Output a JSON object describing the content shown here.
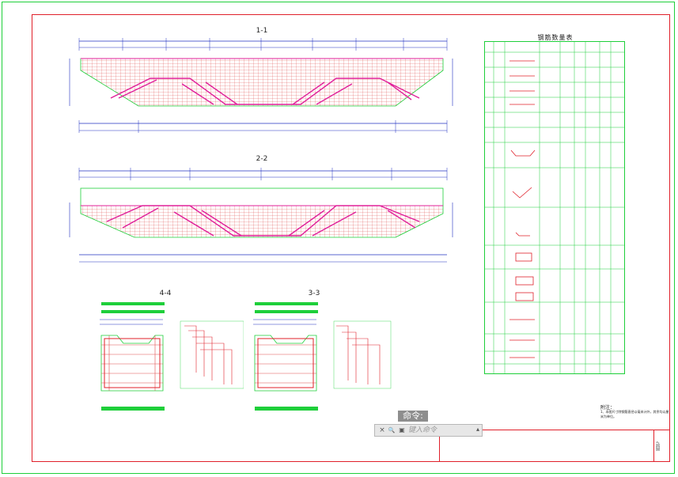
{
  "drawing": {
    "section_1_title": "1-1",
    "section_2_title": "2-2",
    "section_3_title": "3-3",
    "section_4_title": "4-4",
    "table_title": "钢筋数量表",
    "note_title": "附注：",
    "note_line": "1、本图尺寸除钢筋直径以毫米计外，其余均以厘米为单位。",
    "stamp_text": "图号"
  },
  "command_line": {
    "label": "命令:",
    "placeholder": "键入命令",
    "close_glyph": "×",
    "search_glyph": "🔍",
    "recent_glyph": "▣",
    "dropdown_glyph": "▴"
  },
  "colors": {
    "frame_green": "#1ecf3a",
    "frame_red": "#e0202a",
    "rebar_magenta": "#e0209a",
    "grid_red": "#e05050",
    "dim_blue": "#2030c0"
  }
}
